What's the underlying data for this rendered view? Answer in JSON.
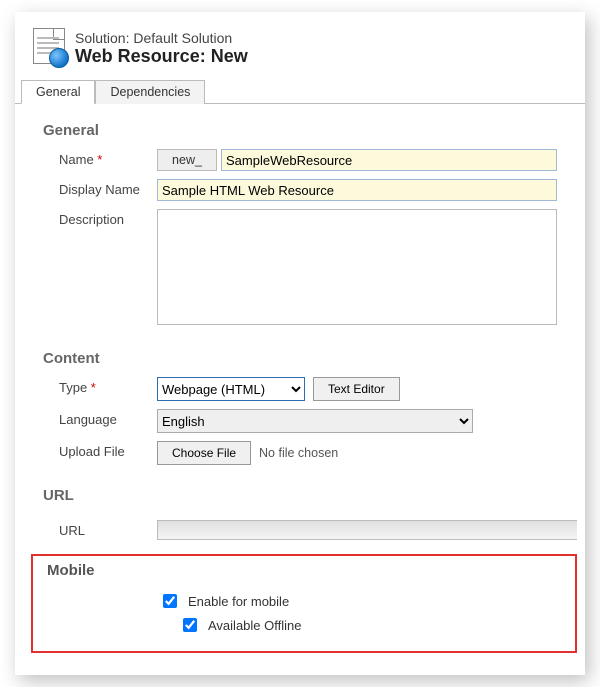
{
  "header": {
    "solution_line": "Solution: Default Solution",
    "title": "Web Resource: New"
  },
  "tabs": {
    "general": "General",
    "dependencies": "Dependencies"
  },
  "general": {
    "section": "General",
    "name_label": "Name",
    "name_prefix": "new_",
    "name_value": "SampleWebResource",
    "displayname_label": "Display Name",
    "displayname_value": "Sample HTML Web Resource",
    "description_label": "Description",
    "description_value": ""
  },
  "content": {
    "section": "Content",
    "type_label": "Type",
    "type_value": "Webpage (HTML)",
    "text_editor_btn": "Text Editor",
    "language_label": "Language",
    "language_value": "English",
    "upload_label": "Upload File",
    "choose_btn": "Choose File",
    "no_file_text": "No file chosen"
  },
  "url": {
    "section": "URL",
    "label": "URL",
    "value": ""
  },
  "mobile": {
    "section": "Mobile",
    "enable_label": "Enable for mobile",
    "offline_label": "Available Offline"
  }
}
